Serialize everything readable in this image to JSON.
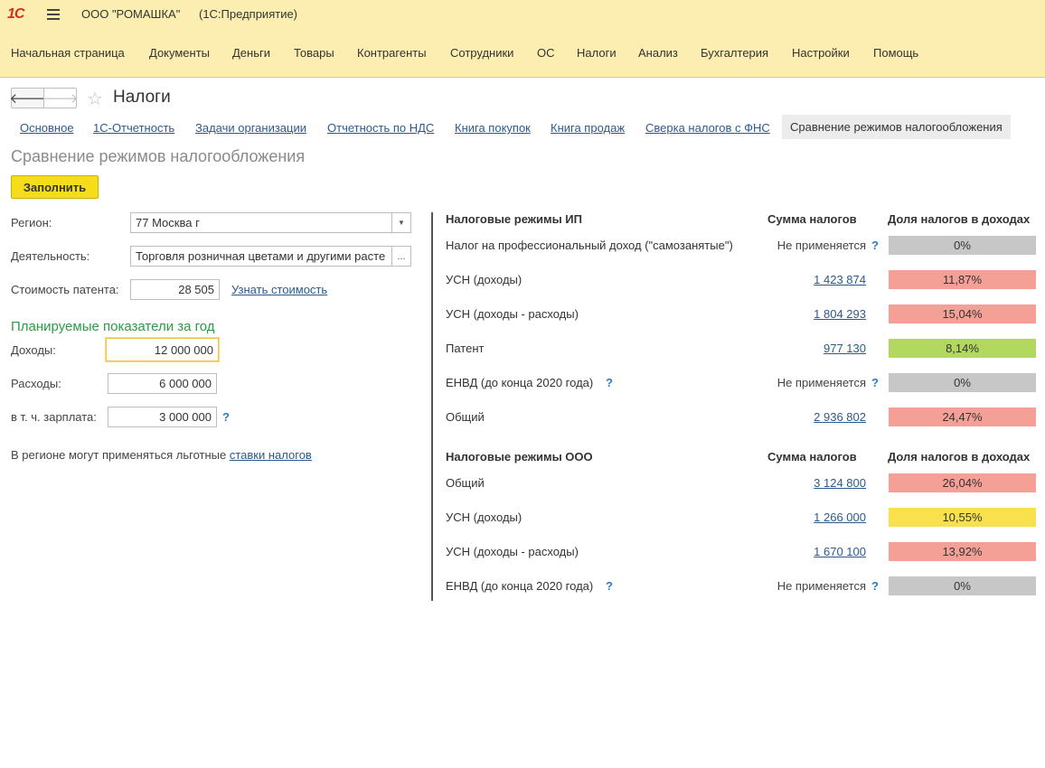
{
  "app": {
    "logo": "1С",
    "org": "ООО \"РОМАШКА\"",
    "product": "(1С:Предприятие)"
  },
  "sections": [
    "Начальная страница",
    "Документы",
    "Деньги",
    "Товары",
    "Контрагенты",
    "Сотрудники",
    "ОС",
    "Налоги",
    "Анализ",
    "Бухгалтерия",
    "Настройки",
    "Помощь"
  ],
  "nav": {
    "back": "🡐",
    "forward": "🡒",
    "title": "Налоги"
  },
  "tabs": [
    "Основное",
    "1С-Отчетность",
    "Задачи организации",
    "Отчетность по НДС",
    "Книга покупок",
    "Книга продаж",
    "Сверка налогов с ФНС",
    "Сравнение режимов налогообложения"
  ],
  "form": {
    "heading": "Сравнение режимов налогообложения",
    "fill_button": "Заполнить",
    "region_label": "Регион:",
    "region_value": "77 Москва г",
    "activity_label": "Деятельность:",
    "activity_value": "Торговля розничная цветами и другими расте",
    "activity_btn": "...",
    "patent_label": "Стоимость патента:",
    "patent_value": "28 505",
    "patent_link": "Узнать стоимость",
    "planned_heading": "Планируемые показатели за год",
    "income_label": "Доходы:",
    "income_value": "12 000 000",
    "expense_label": "Расходы:",
    "expense_value": "6 000 000",
    "salary_label": "в т. ч. зарплата:",
    "salary_value": "3 000 000",
    "note_text": "В регионе могут применяться льготные ",
    "note_link": "ставки налогов"
  },
  "colors": {
    "gray": "#c7c7c7",
    "red": "#f4a096",
    "green": "#b2d860",
    "yellow": "#f8e14c"
  },
  "ip": {
    "header": "Налоговые режимы ИП",
    "sum_header": "Сумма налогов",
    "share_header": "Доля налогов в доходах",
    "rows": [
      {
        "name": "Налог на профессиональный доход (\"самозанятые\")",
        "sum": "Не применяется",
        "share": "0%",
        "color": "gray",
        "q": "?"
      },
      {
        "name": "УСН (доходы)",
        "sum": "1 423 874",
        "share": "11,87%",
        "color": "red"
      },
      {
        "name": "УСН (доходы - расходы)",
        "sum": "1 804 293",
        "share": "15,04%",
        "color": "red"
      },
      {
        "name": "Патент",
        "sum": "977 130",
        "share": "8,14%",
        "color": "green"
      },
      {
        "name": "ЕНВД (до конца 2020 года)",
        "sum": "Не применяется",
        "share": "0%",
        "color": "gray",
        "q": "?",
        "name_q": "?"
      },
      {
        "name": "Общий",
        "sum": "2 936 802",
        "share": "24,47%",
        "color": "red"
      }
    ]
  },
  "ooo": {
    "header": "Налоговые режимы ООО",
    "sum_header": "Сумма налогов",
    "share_header": "Доля налогов в доходах",
    "rows": [
      {
        "name": "Общий",
        "sum": "3 124 800",
        "share": "26,04%",
        "color": "red"
      },
      {
        "name": "УСН (доходы)",
        "sum": "1 266 000",
        "share": "10,55%",
        "color": "yellow"
      },
      {
        "name": "УСН (доходы - расходы)",
        "sum": "1 670 100",
        "share": "13,92%",
        "color": "red"
      },
      {
        "name": "ЕНВД (до конца 2020 года)",
        "sum": "Не применяется",
        "share": "0%",
        "color": "gray",
        "q": "?",
        "name_q": "?"
      }
    ]
  }
}
